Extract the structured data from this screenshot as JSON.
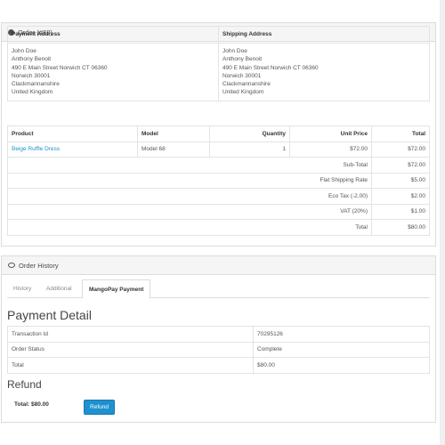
{
  "order_panel": {
    "title": "Order (#32)",
    "payment_address_header": "Payment Address",
    "shipping_address_header": "Shipping Address",
    "payment_address_lines": [
      "John Doe",
      "Anthony Benoit",
      "490 E Main Street Norwich CT 06360",
      "Norwich 30001",
      "Clackmannanshire",
      "United Kingdom"
    ],
    "shipping_address_lines": [
      "John Doe",
      "Anthony Benoit",
      "490 E Main Street Norwich CT 06360",
      "Norwich 30001",
      "Clackmannanshire",
      "United Kingdom"
    ],
    "product_headers": {
      "product": "Product",
      "model": "Model",
      "quantity": "Quantity",
      "unit_price": "Unit Price",
      "total": "Total"
    },
    "product": {
      "name": "Beige Ruffle Dress",
      "model": "Model 68",
      "quantity": "1",
      "unit_price": "$72.00",
      "total": "$72.00"
    },
    "totals": [
      {
        "label": "Sub-Total",
        "value": "$72.00"
      },
      {
        "label": "Flat Shipping Rate",
        "value": "$5.00"
      },
      {
        "label": "Eco Tax (-2.00)",
        "value": "$2.00"
      },
      {
        "label": "VAT (20%)",
        "value": "$1.00"
      },
      {
        "label": "Total",
        "value": "$80.00"
      }
    ]
  },
  "history_panel": {
    "title": "Order History",
    "tabs": [
      "History",
      "Additional",
      "MangoPay Payment"
    ],
    "active_tab": 2
  },
  "payment_detail": {
    "title": "Payment Detail",
    "rows": [
      {
        "label": "Transaction Id",
        "value": "70295126"
      },
      {
        "label": "Order Status",
        "value": "Complete"
      },
      {
        "label": "Total",
        "value": "$80.00"
      }
    ]
  },
  "refund": {
    "title": "Refund",
    "total_text": "Total: $80.00",
    "button_label": "Refund"
  },
  "colors": {
    "accent": "#1e91cf",
    "border": "#dcdcdc",
    "heading_bg": "#f5f5f5"
  },
  "icons": {
    "order": "info-circle-icon",
    "history": "comment-icon"
  }
}
